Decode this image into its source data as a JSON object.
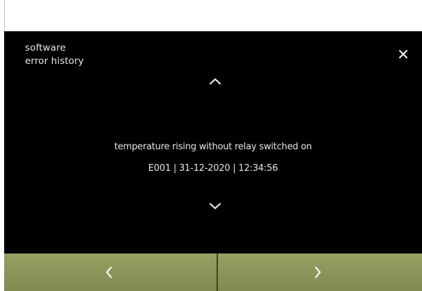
{
  "header": {
    "title_line1": "software",
    "title_line2": "error history"
  },
  "entry": {
    "description": "temperature rising without relay switched on",
    "meta": "E001  |  31-12-2020  |  12:34:56"
  },
  "icons": {
    "close": "close-icon",
    "up": "chevron-up-icon",
    "down": "chevron-down-icon",
    "prev": "chevron-left-icon",
    "next": "chevron-right-icon"
  },
  "colors": {
    "screen_background": "#000000",
    "footer_background": "#8e9a5c",
    "text": "#e8e8e8"
  }
}
